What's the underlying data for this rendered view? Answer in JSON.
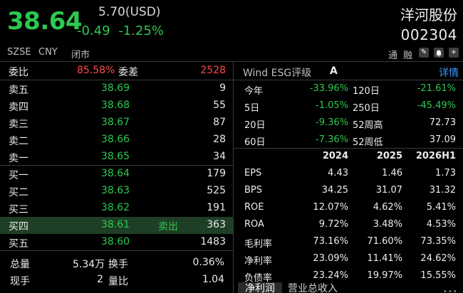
{
  "header": {
    "price": "38.64",
    "usd_price": "5.70(USD)",
    "change": "-0.49",
    "change_pct": "-1.25%",
    "stock_name": "洋河股份",
    "stock_code": "002304",
    "exchange": "SZSE",
    "currency": "CNY",
    "status": "闭市",
    "tool_a": "通",
    "tool_b": "融"
  },
  "order_book": {
    "ratio_label": "委比",
    "ratio_value": "85.58%",
    "diff_label": "委差",
    "diff_value": "2528",
    "asks": [
      {
        "label": "卖五",
        "price": "38.69",
        "volume": "9"
      },
      {
        "label": "卖四",
        "price": "38.68",
        "volume": "55"
      },
      {
        "label": "卖三",
        "price": "38.67",
        "volume": "87"
      },
      {
        "label": "卖二",
        "price": "38.66",
        "volume": "28"
      },
      {
        "label": "卖一",
        "price": "38.65",
        "volume": "34"
      }
    ],
    "bids": [
      {
        "label": "买一",
        "price": "38.64",
        "volume": "179",
        "tag": ""
      },
      {
        "label": "买二",
        "price": "38.63",
        "volume": "525",
        "tag": ""
      },
      {
        "label": "买三",
        "price": "38.62",
        "volume": "191",
        "tag": ""
      },
      {
        "label": "买四",
        "price": "38.61",
        "volume": "363",
        "tag": "卖出"
      },
      {
        "label": "买五",
        "price": "38.60",
        "volume": "1483",
        "tag": ""
      }
    ]
  },
  "stats": {
    "total_volume_label": "总量",
    "total_volume": "5.34万",
    "turnover_label": "换手",
    "turnover": "0.36%",
    "current_label": "现手",
    "current": "2",
    "vol_ratio_label": "量比",
    "vol_ratio": "1.04"
  },
  "esg": {
    "label": "Wind ESG评级",
    "rating": "A",
    "detail_link": "详情"
  },
  "returns": [
    {
      "l1": "今年",
      "v1": "-33.96%",
      "l2": "120日",
      "v2": "-21.61%"
    },
    {
      "l1": "5日",
      "v1": "-1.05%",
      "l2": "250日",
      "v2": "-45.49%"
    },
    {
      "l1": "20日",
      "v1": "-9.36%",
      "l2": "52周高",
      "v2": "72.73"
    },
    {
      "l1": "60日",
      "v1": "-7.36%",
      "l2": "52周低",
      "v2": "37.09"
    }
  ],
  "financials": {
    "years": [
      "2024",
      "2025",
      "2026H1"
    ],
    "rows": [
      {
        "label": "EPS",
        "values": [
          "4.43",
          "1.46",
          "1.73"
        ]
      },
      {
        "label": "BPS",
        "values": [
          "34.25",
          "31.07",
          "31.32"
        ]
      },
      {
        "label": "ROE",
        "values": [
          "12.07%",
          "4.62%",
          "5.41%"
        ]
      },
      {
        "label": "ROA",
        "values": [
          "9.72%",
          "3.48%",
          "4.53%"
        ]
      },
      {
        "label": "毛利率",
        "values": [
          "73.16%",
          "71.60%",
          "73.35%"
        ]
      },
      {
        "label": "净利率",
        "values": [
          "23.09%",
          "11.41%",
          "24.62%"
        ]
      },
      {
        "label": "负债率",
        "values": [
          "23.24%",
          "19.97%",
          "15.55%"
        ]
      }
    ]
  },
  "tabs": [
    "净利润",
    "营业总收入"
  ],
  "colors": {
    "up": "#ff4a4a",
    "down": "#2ec84f",
    "link": "#3a9bff",
    "highlight": "#1e3e25"
  }
}
